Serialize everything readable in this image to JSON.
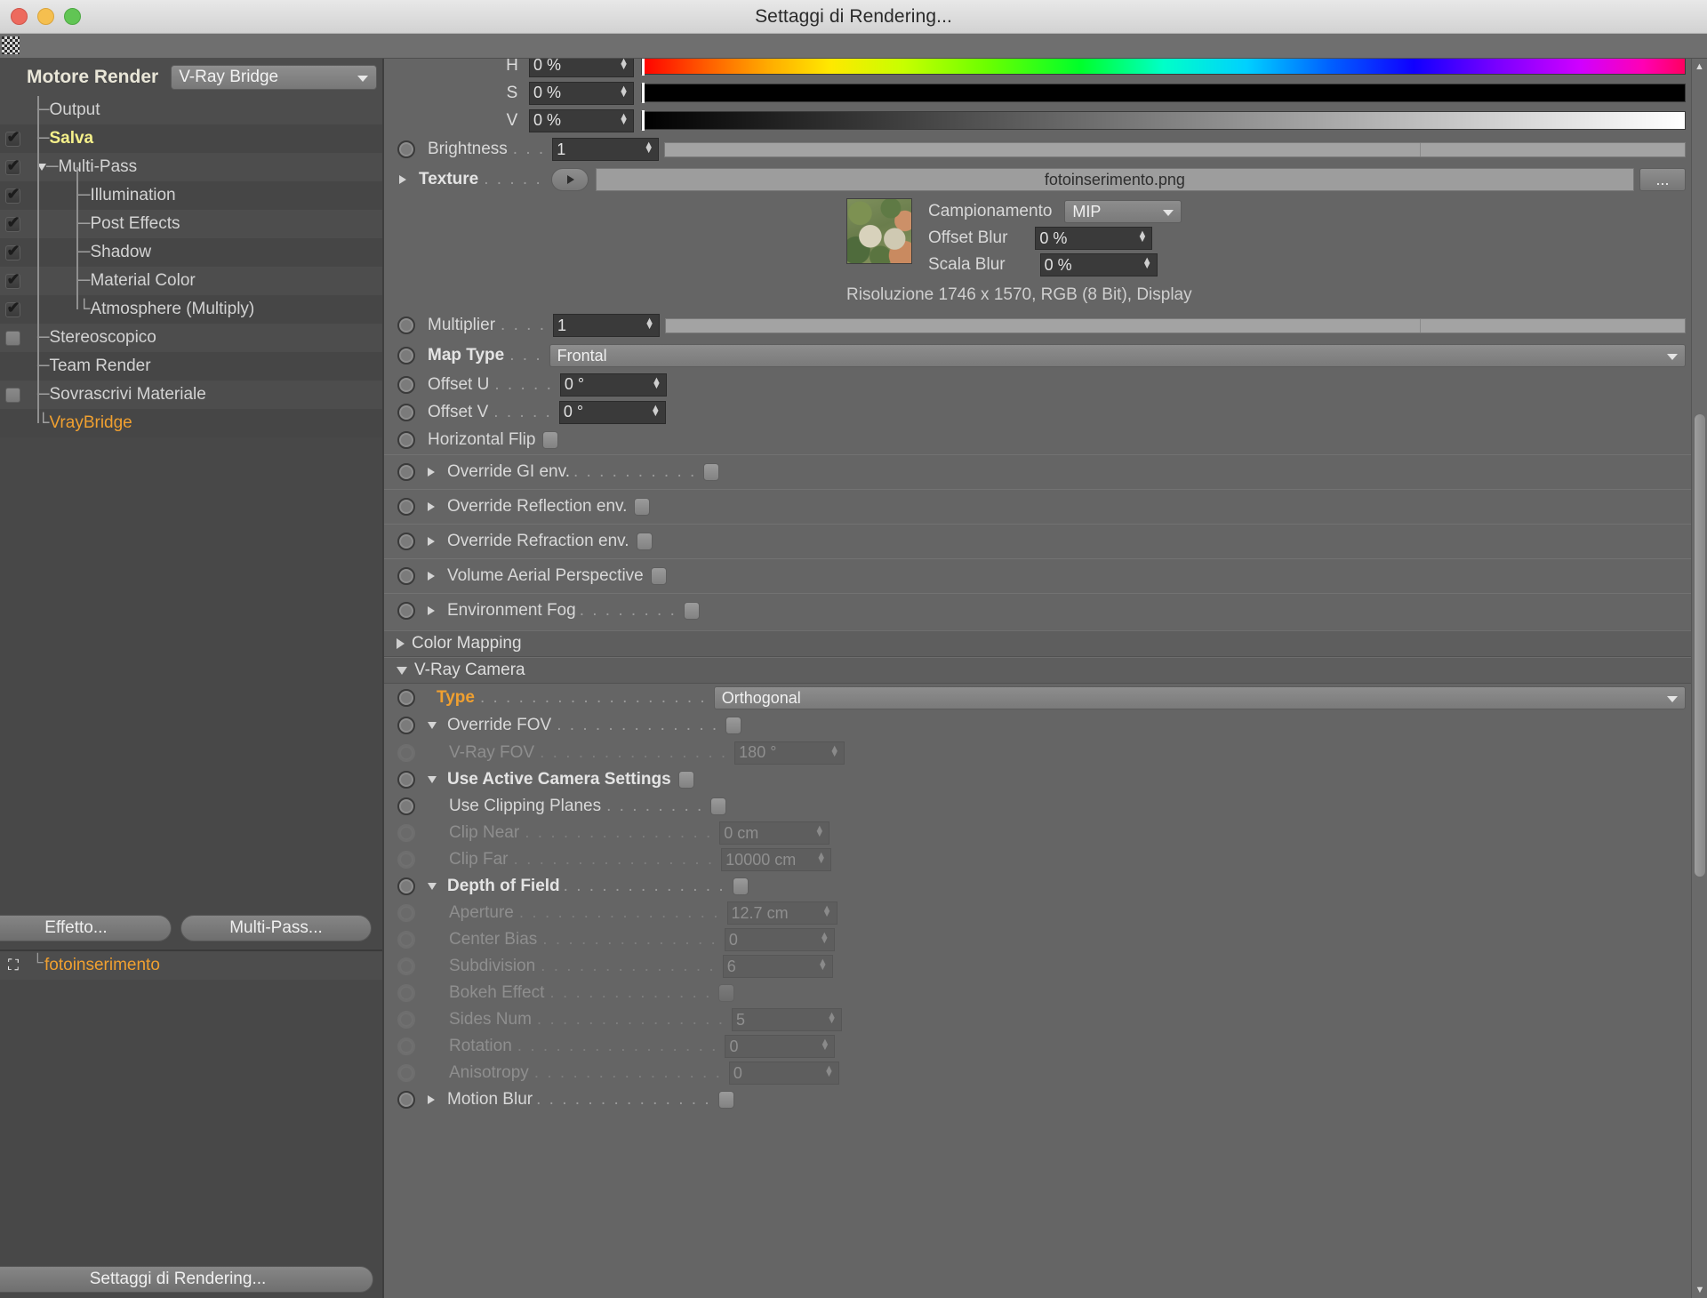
{
  "window": {
    "title": "Settaggi di Rendering..."
  },
  "sidebar": {
    "engine_label": "Motore Render",
    "engine_value": "V-Ray Bridge",
    "tree": [
      {
        "label": "Output",
        "check": "none",
        "indent": 1,
        "style": "normal"
      },
      {
        "label": "Salva",
        "check": "on",
        "indent": 1,
        "style": "yellow"
      },
      {
        "label": "Multi-Pass",
        "check": "on",
        "indent": 1,
        "style": "normal",
        "expander": "down"
      },
      {
        "label": "Illumination",
        "check": "on",
        "indent": 2,
        "style": "normal"
      },
      {
        "label": "Post Effects",
        "check": "on",
        "indent": 2,
        "style": "normal"
      },
      {
        "label": "Shadow",
        "check": "on",
        "indent": 2,
        "style": "normal"
      },
      {
        "label": "Material Color",
        "check": "on",
        "indent": 2,
        "style": "normal"
      },
      {
        "label": "Atmosphere (Multiply)",
        "check": "on",
        "indent": 2,
        "style": "normal",
        "last": true
      },
      {
        "label": "Stereoscopico",
        "check": "empty",
        "indent": 1,
        "style": "normal"
      },
      {
        "label": "Team Render",
        "check": "none",
        "indent": 1,
        "style": "normal"
      },
      {
        "label": "Sovrascrivi Materiale",
        "check": "empty",
        "indent": 1,
        "style": "normal"
      },
      {
        "label": "VrayBridge",
        "check": "none",
        "indent": 1,
        "style": "orange",
        "last": true
      }
    ],
    "buttons": {
      "effect": "Effetto...",
      "multipass": "Multi-Pass..."
    },
    "object": {
      "name": "fotoinserimento"
    },
    "bottom_button": "Settaggi di Rendering..."
  },
  "main": {
    "hsv": [
      {
        "label": "H",
        "value": "0 %",
        "bar": "hue"
      },
      {
        "label": "S",
        "value": "0 %",
        "bar": "sat"
      },
      {
        "label": "V",
        "value": "0 %",
        "bar": "val"
      }
    ],
    "brightness": {
      "label": "Brightness",
      "dots": ". . .",
      "value": "1"
    },
    "texture": {
      "label": "Texture",
      "dots": ". . . . .",
      "value": "fotoinserimento.png",
      "browse": "..."
    },
    "texture_props": {
      "campionamento_label": "Campionamento",
      "campionamento_value": "MIP",
      "offset_blur_label": "Offset Blur",
      "offset_blur_value": "0 %",
      "scala_blur_label": "Scala Blur",
      "scala_blur_value": "0 %",
      "resolution": "Risoluzione 1746 x 1570, RGB (8 Bit), Display"
    },
    "multiplier": {
      "label": "Multiplier",
      "dots": ". . . .",
      "value": "1"
    },
    "map_type": {
      "label": "Map Type",
      "dots": ". . .",
      "value": "Frontal"
    },
    "offset_u": {
      "label": "Offset U",
      "dots": ". . . . .",
      "value": "0 °"
    },
    "offset_v": {
      "label": "Offset V",
      "dots": ". . . . .",
      "value": "0 °"
    },
    "horizontal_flip": {
      "label": "Horizontal Flip",
      "checked": false
    },
    "overrides": [
      {
        "label": "Override GI env.",
        "dots": ". . . . . . . . . ."
      },
      {
        "label": "Override Reflection env.",
        "dots": ""
      },
      {
        "label": "Override Refraction env.",
        "dots": ""
      },
      {
        "label": "Volume Aerial Perspective",
        "dots": ""
      },
      {
        "label": "Environment Fog",
        "dots": ". . . . . . . ."
      }
    ],
    "section_color_mapping": "Color Mapping",
    "section_vray_camera": "V-Ray Camera",
    "camera": {
      "type": {
        "label": "Type",
        "dots": ". . . . . . . . . . . . . . . . . .",
        "value": "Orthogonal"
      },
      "override_fov": {
        "label": "Override FOV",
        "dots": ". . . . . . . . . . . . ."
      },
      "vray_fov": {
        "label": "V-Ray FOV",
        "dots": ". . . . . . . . . . . . . . .",
        "value": "180 °"
      },
      "use_active_camera": {
        "label": "Use Active Camera Settings"
      },
      "use_clipping_planes": {
        "label": "Use Clipping Planes",
        "dots": ". . . . . . . ."
      },
      "clip_near": {
        "label": "Clip Near",
        "dots": ". . . . . . . . . . . . . . .",
        "value": "0 cm"
      },
      "clip_far": {
        "label": "Clip Far",
        "dots": ". . . . . . . . . . . . . . . .",
        "value": "10000 cm"
      },
      "depth_of_field": {
        "label": "Depth of Field",
        "dots": ". . . . . . . . . . . . ."
      },
      "aperture": {
        "label": "Aperture",
        "dots": ". . . . . . . . . . . . . . . .",
        "value": "12.7 cm"
      },
      "center_bias": {
        "label": "Center Bias",
        "dots": ". . . . . . . . . . . . . .",
        "value": "0"
      },
      "subdivision": {
        "label": "Subdivision",
        "dots": ". . . . . . . . . . . . . .",
        "value": "6"
      },
      "bokeh_effect": {
        "label": "Bokeh Effect",
        "dots": ". . . . . . . . . . . . ."
      },
      "sides_num": {
        "label": "Sides Num",
        "dots": ". . . . . . . . . . . . . . .",
        "value": "5"
      },
      "rotation": {
        "label": "Rotation",
        "dots": ". . . . . . . . . . . . . . . .",
        "value": "0"
      },
      "anisotropy": {
        "label": "Anisotropy",
        "dots": ". . . . . . . . . . . . . . .",
        "value": "0"
      },
      "motion_blur": {
        "label": "Motion Blur",
        "dots": ". . . . . . . . . . . . . ."
      }
    }
  },
  "colors": {
    "accent_orange": "#f0a030",
    "accent_yellow": "#f5f08a",
    "panel_bg": "#656565",
    "sidebar_bg": "#484848"
  }
}
